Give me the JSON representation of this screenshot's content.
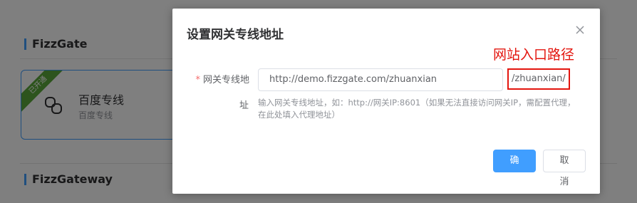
{
  "background": {
    "section1_title": "FizzGate",
    "section2_title": "FizzGateway",
    "card": {
      "ribbon": "已开通",
      "name": "百度专线",
      "subtitle": "百度专线",
      "icon": "link-icon"
    }
  },
  "dialog": {
    "title": "设置网关专线地址",
    "close_icon": "close-icon",
    "annotation": "网站入口路径",
    "field": {
      "required_mark": "*",
      "label_line1": "网关专线地",
      "label_line2": "址",
      "value": "http://demo.fizzgate.com/zhuanxian",
      "suffix": "/zhuanxian/",
      "hint": "输入网关专线地址，如：http://网关IP:8601（如果无法直接访问网关IP，需配置代理，在此处填入代理地址）"
    },
    "buttons": {
      "confirm": "确 定",
      "cancel": "取 消"
    }
  },
  "colors": {
    "primary": "#409eff",
    "annotation_red": "#e3150e",
    "ribbon_green": "#5aa83b"
  }
}
